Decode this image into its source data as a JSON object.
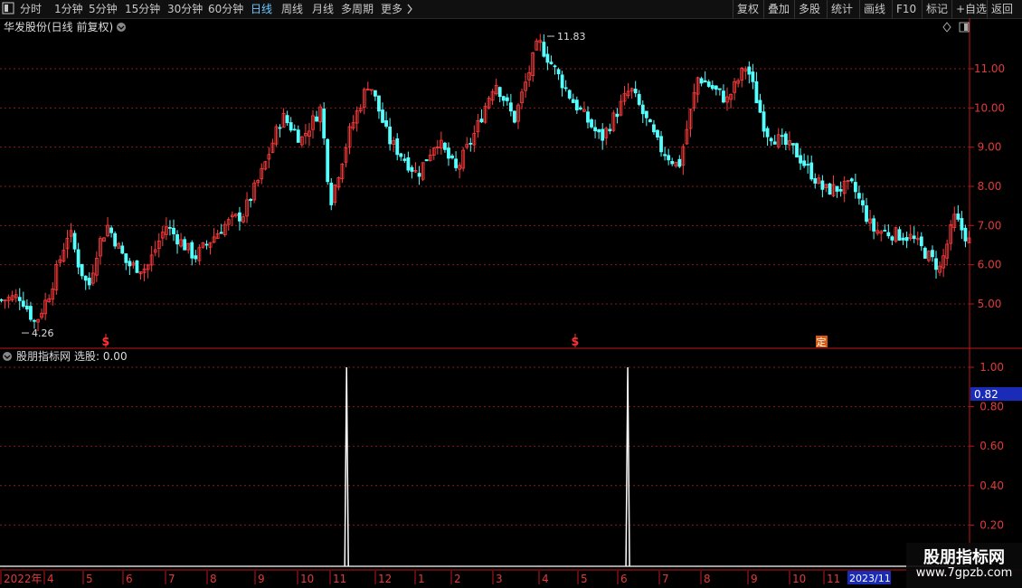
{
  "toolbar": {
    "left_items": [
      {
        "label": "分时",
        "active": false
      },
      {
        "label": "1分钟",
        "active": false
      },
      {
        "label": "5分钟",
        "active": false
      },
      {
        "label": "15分钟",
        "active": false
      },
      {
        "label": "30分钟",
        "active": false
      },
      {
        "label": "60分钟",
        "active": false
      },
      {
        "label": "日线",
        "active": true
      },
      {
        "label": "周线",
        "active": false
      },
      {
        "label": "月线",
        "active": false
      },
      {
        "label": "多周期",
        "active": false
      },
      {
        "label": "更多",
        "active": false
      }
    ],
    "more_icon": "chevron-right-icon",
    "right_items": [
      "复权",
      "叠加",
      "多股",
      "统计",
      "画线",
      "F10",
      "标记",
      "+自选",
      "返回"
    ],
    "window_icon": "window-icon"
  },
  "main_panel": {
    "title": "华发股份(日线 前复权)",
    "y_ticks": [
      "11.00",
      "10.00",
      "9.00",
      "8.00",
      "7.00",
      "6.00",
      "5.00"
    ],
    "high_label": "11.83",
    "low_label": "4.26",
    "signals": [
      {
        "text": "S",
        "x": 117
      },
      {
        "text": "S",
        "x": 636
      },
      {
        "text": "定",
        "x": 908
      }
    ]
  },
  "indicator_panel": {
    "title": "股朋指标网",
    "subtitle": "选股: 0.00",
    "y_ticks": [
      "1.00",
      "0.80",
      "0.60",
      "0.40",
      "0.20"
    ],
    "current_value": "0.82"
  },
  "x_axis": {
    "labels": [
      {
        "text": "2022年",
        "x": 2
      },
      {
        "text": "4",
        "x": 50
      },
      {
        "text": "5",
        "x": 93
      },
      {
        "text": "6",
        "x": 137
      },
      {
        "text": "7",
        "x": 184
      },
      {
        "text": "8",
        "x": 230
      },
      {
        "text": "9",
        "x": 283
      },
      {
        "text": "10",
        "x": 330
      },
      {
        "text": "11",
        "x": 366
      },
      {
        "text": "12",
        "x": 416
      },
      {
        "text": "1",
        "x": 460
      },
      {
        "text": "2",
        "x": 500
      },
      {
        "text": "3",
        "x": 546
      },
      {
        "text": "4",
        "x": 597
      },
      {
        "text": "5",
        "x": 640
      },
      {
        "text": "6",
        "x": 684
      },
      {
        "text": "7",
        "x": 730
      },
      {
        "text": "8",
        "x": 776
      },
      {
        "text": "9",
        "x": 828
      },
      {
        "text": "10",
        "x": 874
      },
      {
        "text": "11",
        "x": 912
      }
    ],
    "current_label": "2023/11"
  },
  "watermark": {
    "line1": "股朋指标网",
    "line2": "www.7gpzb.com"
  },
  "colors": {
    "up": "#ff3c3c",
    "down": "#54ffff",
    "grid": "#8b1a1a",
    "axis": "#c01818",
    "indicator": "#ffffff",
    "highlight": "#1a2bb8"
  },
  "chart_data": {
    "type": "candlestick",
    "title": "华发股份(日线 前复权)",
    "y_range": [
      4.26,
      11.83
    ],
    "high": 11.83,
    "low": 4.26,
    "price_path": [
      {
        "t": 0,
        "v": 5.1
      },
      {
        "t": 0.02,
        "v": 5.2
      },
      {
        "t": 0.035,
        "v": 4.5
      },
      {
        "t": 0.05,
        "v": 5.3
      },
      {
        "t": 0.07,
        "v": 6.9
      },
      {
        "t": 0.08,
        "v": 6.0
      },
      {
        "t": 0.09,
        "v": 5.4
      },
      {
        "t": 0.1,
        "v": 6.5
      },
      {
        "t": 0.11,
        "v": 7.0
      },
      {
        "t": 0.13,
        "v": 6.0
      },
      {
        "t": 0.15,
        "v": 5.9
      },
      {
        "t": 0.17,
        "v": 7.0
      },
      {
        "t": 0.2,
        "v": 6.2
      },
      {
        "t": 0.23,
        "v": 7.0
      },
      {
        "t": 0.25,
        "v": 7.3
      },
      {
        "t": 0.27,
        "v": 8.4
      },
      {
        "t": 0.29,
        "v": 9.8
      },
      {
        "t": 0.31,
        "v": 9.2
      },
      {
        "t": 0.33,
        "v": 10.0
      },
      {
        "t": 0.34,
        "v": 7.6
      },
      {
        "t": 0.36,
        "v": 9.4
      },
      {
        "t": 0.38,
        "v": 10.7
      },
      {
        "t": 0.4,
        "v": 9.2
      },
      {
        "t": 0.43,
        "v": 8.3
      },
      {
        "t": 0.45,
        "v": 9.2
      },
      {
        "t": 0.47,
        "v": 8.4
      },
      {
        "t": 0.49,
        "v": 9.4
      },
      {
        "t": 0.51,
        "v": 10.7
      },
      {
        "t": 0.53,
        "v": 9.7
      },
      {
        "t": 0.555,
        "v": 11.7
      },
      {
        "t": 0.59,
        "v": 10.2
      },
      {
        "t": 0.62,
        "v": 9.2
      },
      {
        "t": 0.65,
        "v": 10.5
      },
      {
        "t": 0.68,
        "v": 9.0
      },
      {
        "t": 0.7,
        "v": 8.5
      },
      {
        "t": 0.72,
        "v": 10.8
      },
      {
        "t": 0.75,
        "v": 10.2
      },
      {
        "t": 0.77,
        "v": 11.1
      },
      {
        "t": 0.79,
        "v": 9.4
      },
      {
        "t": 0.82,
        "v": 8.9
      },
      {
        "t": 0.85,
        "v": 7.9
      },
      {
        "t": 0.88,
        "v": 8.0
      },
      {
        "t": 0.9,
        "v": 6.9
      },
      {
        "t": 0.94,
        "v": 6.7
      },
      {
        "t": 0.97,
        "v": 5.9
      },
      {
        "t": 0.985,
        "v": 7.2
      },
      {
        "t": 1.0,
        "v": 6.6
      }
    ],
    "indicator": {
      "name": "选股",
      "y_range": [
        0,
        1
      ],
      "spikes": [
        {
          "x_pct": 0.35,
          "value": 1.0
        },
        {
          "x_pct": 0.64,
          "value": 1.0
        }
      ]
    }
  }
}
